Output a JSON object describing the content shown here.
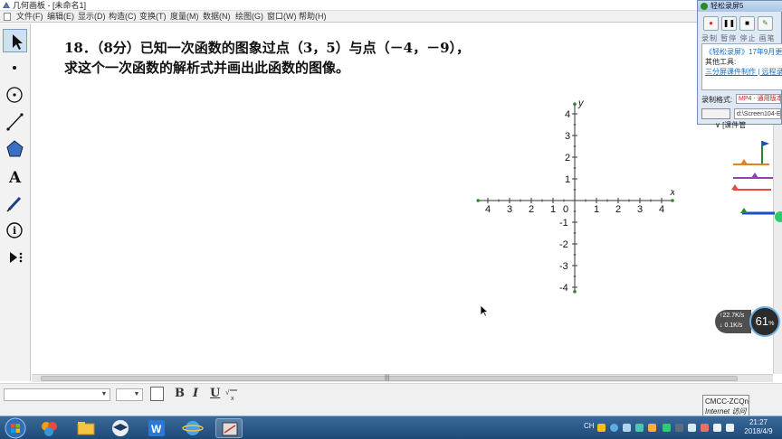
{
  "window": {
    "title": "几何画板 - [未命名1]"
  },
  "menu": {
    "items": [
      "文件(F)",
      "编辑(E)",
      "显示(D)",
      "构造(C)",
      "变换(T)",
      "度量(M)",
      "数据(N)",
      "绘图(G)",
      "窗口(W)",
      "帮助(H)"
    ]
  },
  "toolbox": {
    "tools": [
      "arrow-select-tool",
      "point-tool",
      "compass-tool",
      "straightedge-tool",
      "polygon-tool",
      "text-tool",
      "marker-tool",
      "information-tool",
      "custom-tools"
    ],
    "text_tool_glyph": "A"
  },
  "problem": {
    "line1": "18．（8分）已知一次函数的图象过点（3，5）与点（－4，－9），",
    "line2": "求这个一次函数的解析式并画出此函数的图像。"
  },
  "chart_data": {
    "type": "scatter",
    "title": "",
    "xlabel": "x",
    "ylabel": "y",
    "xlim": [
      -4,
      4
    ],
    "ylim": [
      -4,
      4
    ],
    "x_ticks": [
      "4",
      "3",
      "2",
      "1",
      "0",
      "1",
      "2",
      "3",
      "4"
    ],
    "y_ticks_positive": [
      "4",
      "3",
      "2",
      "1"
    ],
    "y_ticks_negative": [
      "-1",
      "-2",
      "-3",
      "-4"
    ],
    "origin_label": "0",
    "series": []
  },
  "format_bar": {
    "font_value": "",
    "size_value": "",
    "bold": "B",
    "italic": "I",
    "underline": "U"
  },
  "recorder": {
    "title": "轻松录屏5",
    "controls_labels": "录制 暂停 停止 画笔",
    "promo_line1": "《轻松录屏》17年9月更新",
    "promo_line2": "其他工具:",
    "promo_line3": "三分屏课件制作 | 远程录制",
    "format_label": "录制格式:",
    "format_value": "MP4 - 通用版本",
    "path_value": "d:\\Screen104-E",
    "course_label": "∨ [课件管"
  },
  "network": {
    "upload": "↑22.7K/s",
    "download": "↓ 0.1K/s",
    "percent": "61",
    "percent_unit": "%"
  },
  "popup": {
    "line1": "CMCC-ZCQn",
    "line2": "Internet 访问"
  },
  "taskbar": {
    "lang": "CH",
    "time": "21:27",
    "date": "2018/4/9"
  },
  "colors": {
    "taskbar": "#1e4a78",
    "axis": "#333333",
    "recorder_bg": "#dfe9f5",
    "accent_green": "#2a8a2a"
  }
}
